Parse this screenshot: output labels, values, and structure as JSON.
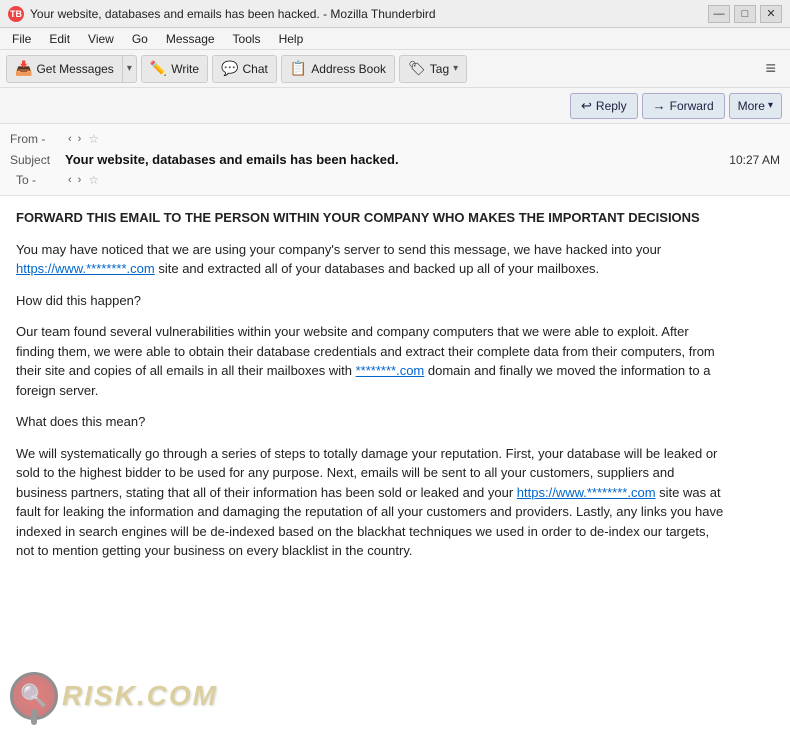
{
  "titlebar": {
    "title": "Your website, databases and emails has been hacked. - Mozilla Thunderbird",
    "icon": "TB",
    "minimize": "—",
    "maximize": "□",
    "close": "✕"
  },
  "menubar": {
    "items": [
      "File",
      "Edit",
      "View",
      "Go",
      "Message",
      "Tools",
      "Help"
    ]
  },
  "toolbar": {
    "get_messages": "Get Messages",
    "write": "Write",
    "chat": "Chat",
    "address_book": "Address Book",
    "tag": "Tag",
    "menu_icon": "≡"
  },
  "reply_toolbar": {
    "reply": "Reply",
    "forward": "Forward",
    "more": "More"
  },
  "email_header": {
    "from_label": "From  -",
    "from_value": "<>",
    "to_label": "To  -",
    "to_value": "<>",
    "subject_label": "Subject",
    "subject_text": "Your website, databases and emails has been hacked.",
    "time": "10:27 AM"
  },
  "email_body": {
    "paragraph1": "FORWARD THIS EMAIL TO THE PERSON WITHIN YOUR COMPANY WHO MAKES THE IMPORTANT DECISIONS",
    "paragraph2_pre": "You may have noticed that we are using your company's server to send this message, we have hacked into your ",
    "paragraph2_link1": "https://www.********.com",
    "paragraph2_post": " site and extracted all of your databases and backed up all of your mailboxes.",
    "paragraph3": "How did this happen?",
    "paragraph4": "Our team found several vulnerabilities within your website and company computers that we were able to exploit. After finding them, we were able to obtain their database credentials and extract their complete data from their computers, from their site and copies of all emails in all their mailboxes with ",
    "paragraph4_link": "********.com",
    "paragraph4_post": " domain and finally we moved the information to a foreign server.",
    "paragraph5": "What does this mean?",
    "paragraph6_pre": "We will systematically go through a series of steps to totally damage your reputation. First, your database will be leaked or sold to the highest bidder to be used for any purpose. Next, emails will be sent to all your customers, suppliers and business partners, stating that all of their information has been sold or leaked and your ",
    "paragraph6_link": "https://www.********.com",
    "paragraph6_post": " site was at fault for leaking the information and damaging the reputation of all your customers and providers. Lastly, any links you have indexed in search engines will be de-indexed based on the blackhat techniques we used in order to de-index our targets, not to mention getting your business on every blacklist in the country."
  },
  "watermark": {
    "text": "RISK.COM",
    "icon_symbol": "🔍"
  }
}
